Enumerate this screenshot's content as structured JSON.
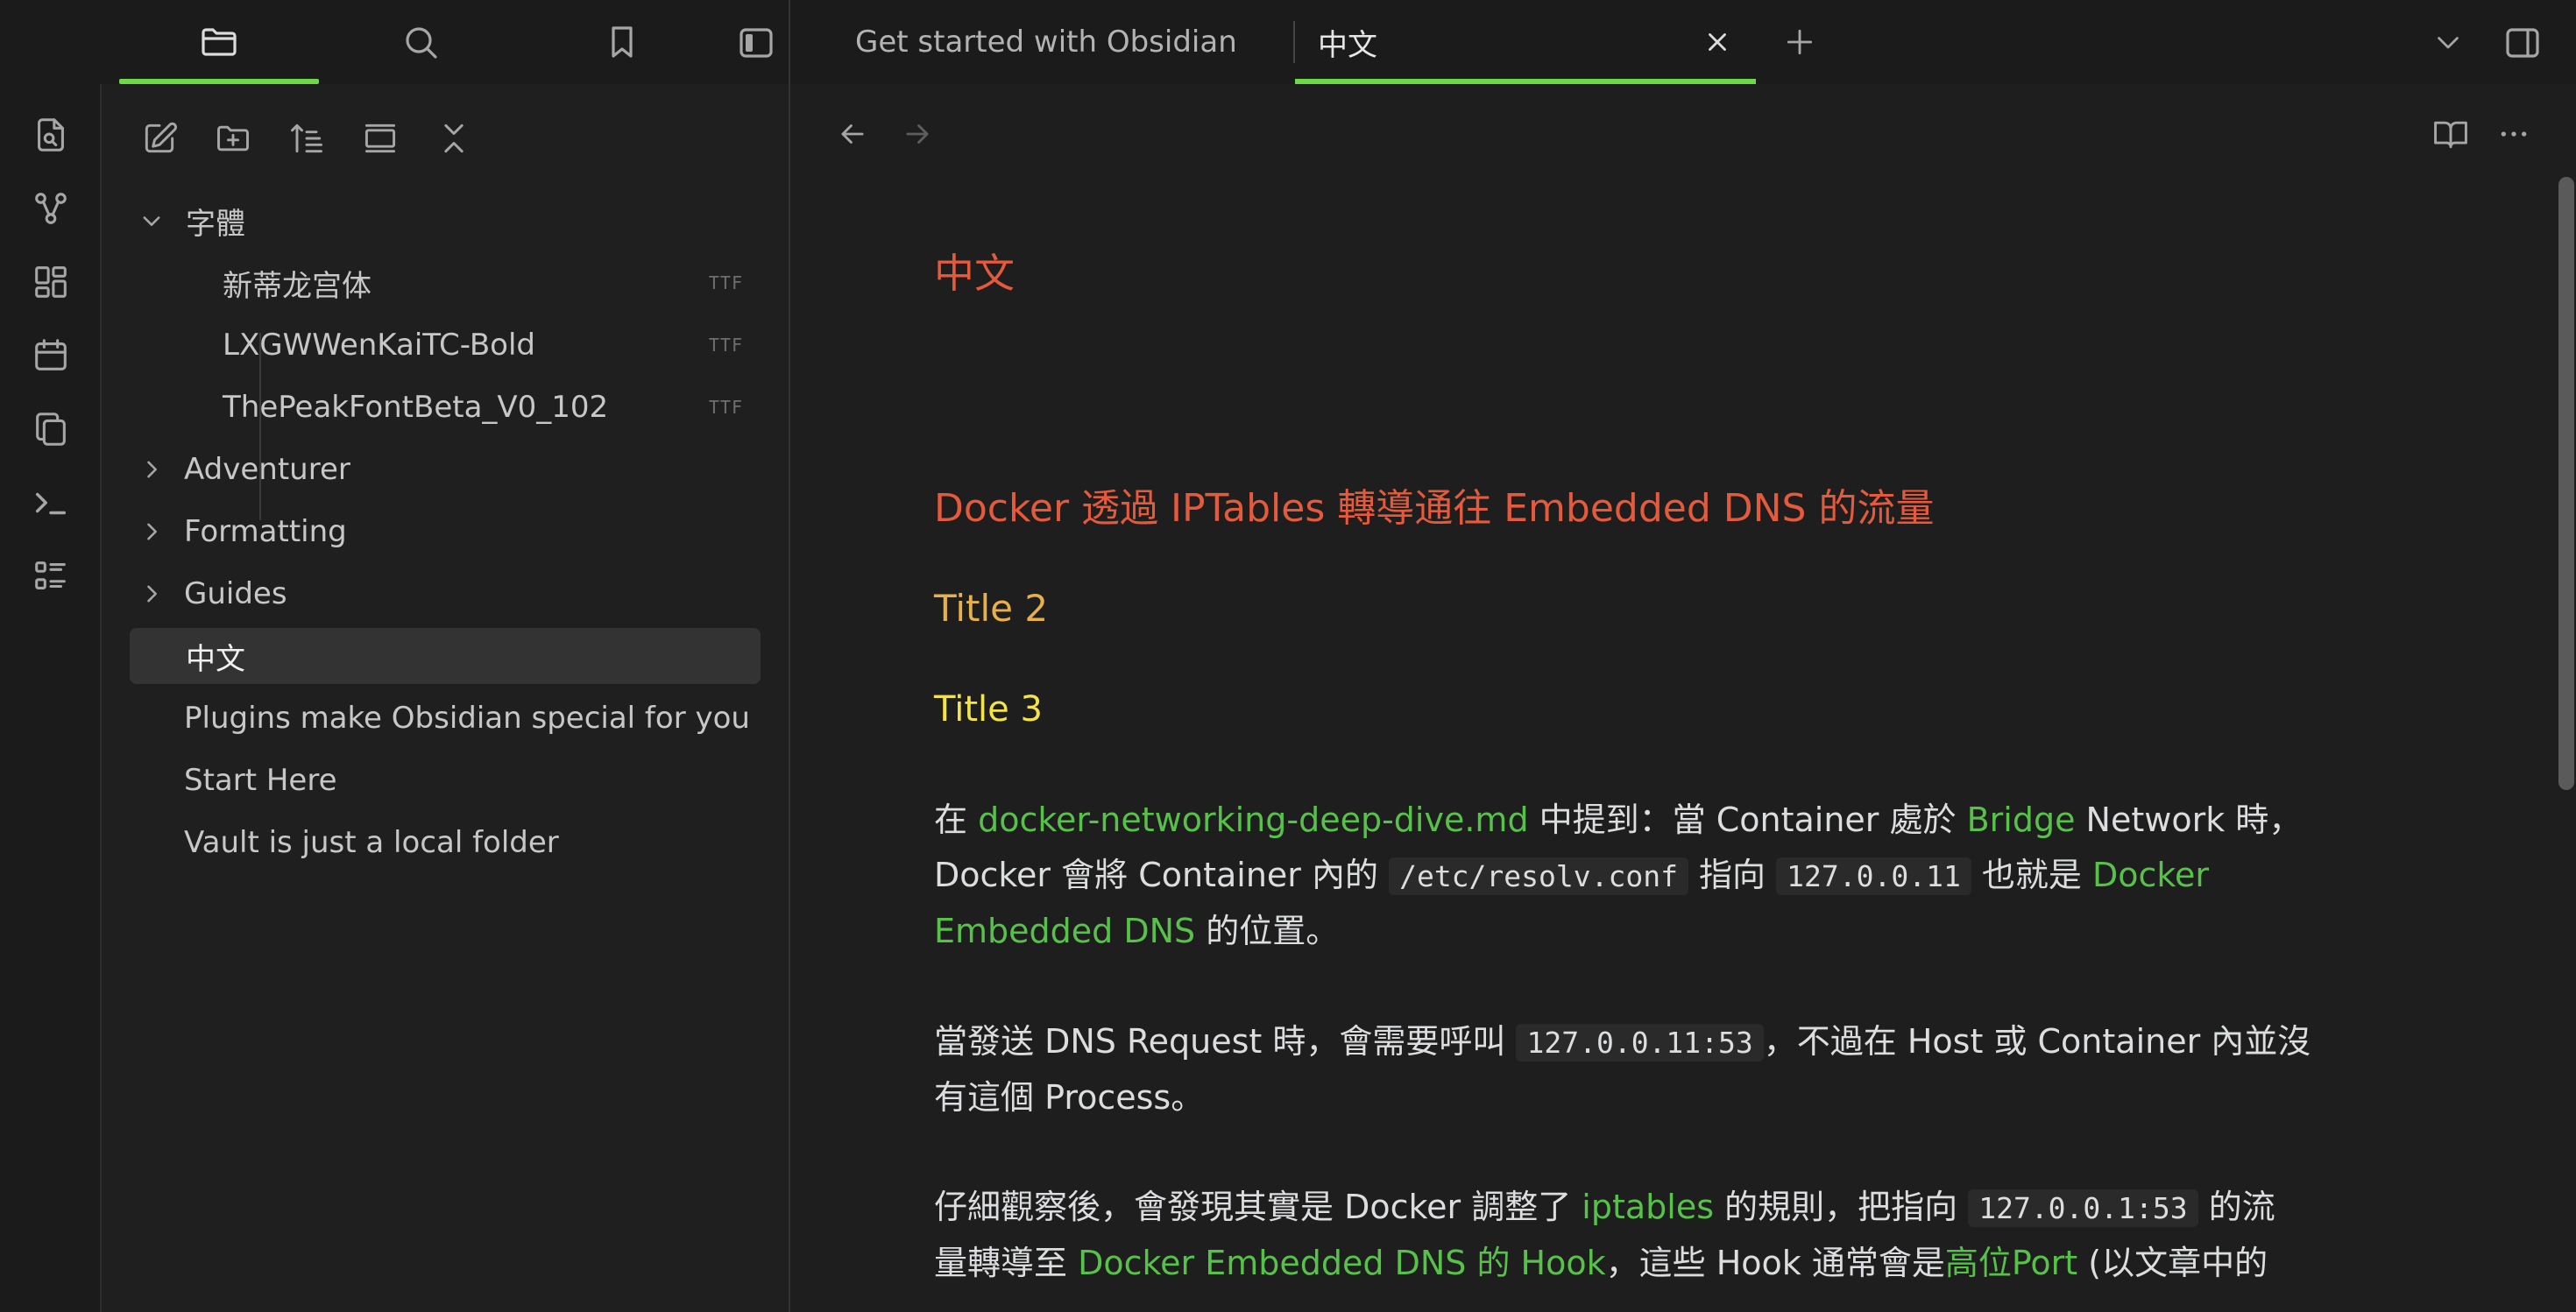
{
  "app": {
    "accent_color": "#6fd84a",
    "heading_colors": {
      "h1": "#e45a3c",
      "h2": "#e8b04a",
      "h3": "#f2e34a",
      "link": "#57c14a"
    }
  },
  "sidebar_tabs": [
    {
      "name": "files",
      "icon": "folder-icon",
      "active": true
    },
    {
      "name": "search",
      "icon": "search-icon",
      "active": false
    },
    {
      "name": "bookmarks",
      "icon": "bookmark-icon",
      "active": false
    }
  ],
  "tabs": [
    {
      "label": "Get started with Obsidian",
      "active": false
    },
    {
      "label": "中文",
      "active": true
    }
  ],
  "ribbon": [
    {
      "icon": "switcher-icon"
    },
    {
      "icon": "graph-icon"
    },
    {
      "icon": "canvas-icon"
    },
    {
      "icon": "calendar-icon"
    },
    {
      "icon": "copy-icon"
    },
    {
      "icon": "terminal-icon"
    },
    {
      "icon": "outline-icon"
    }
  ],
  "explorer": {
    "toolbar": [
      {
        "icon": "new-note-icon"
      },
      {
        "icon": "new-folder-icon"
      },
      {
        "icon": "sort-icon"
      },
      {
        "icon": "auto-reveal-icon"
      },
      {
        "icon": "collapse-all-icon"
      }
    ],
    "tree": [
      {
        "label": "字體",
        "type": "folder",
        "expanded": true
      },
      {
        "label": "新蒂龙宫体",
        "type": "file",
        "badge": "TTF",
        "indent": 1
      },
      {
        "label": "LXGWWenKaiTC-Bold",
        "type": "file",
        "badge": "TTF",
        "indent": 1
      },
      {
        "label": "ThePeakFontBeta_V0_102",
        "type": "file",
        "badge": "TTF",
        "indent": 1
      },
      {
        "label": "Adventurer",
        "type": "folder",
        "expanded": false
      },
      {
        "label": "Formatting",
        "type": "folder",
        "expanded": false
      },
      {
        "label": "Guides",
        "type": "folder",
        "expanded": false
      },
      {
        "label": "中文",
        "type": "file",
        "selected": true
      },
      {
        "label": "Plugins make Obsidian special for you",
        "type": "file"
      },
      {
        "label": "Start Here",
        "type": "file"
      },
      {
        "label": "Vault is just a local folder",
        "type": "file"
      }
    ]
  },
  "document": {
    "title": "中文",
    "heading_docker": "Docker 透過 IPTables 轉導通往 Embedded DNS 的流量",
    "title2": "Title 2",
    "title3": "Title 3",
    "p1": {
      "t1": "在 ",
      "link1": "docker-networking-deep-dive.md",
      "t2": " 中提到：當 Container 處於 ",
      "link2": "Bridge",
      "t3": " Network 時，",
      "t4": "Docker 會將 Container 內的 ",
      "code1": "/etc/resolv.conf",
      "t5": " 指向 ",
      "code2": "127.0.0.11",
      "t6": " 也就是 ",
      "link3a": "Docker",
      "link3b": "Embedded DNS",
      "t7": " 的位置。"
    },
    "p2": {
      "t1": "當發送 DNS Request 時，會需要呼叫 ",
      "code1": "127.0.0.11:53",
      "t2": "，不過在 Host 或 Container 內並沒",
      "t3": "有這個 Process。"
    },
    "p3": {
      "t1": "仔細觀察後，會發現其實是 Docker 調整了 ",
      "link1": "iptables",
      "t2": " 的規則，把指向 ",
      "code1": "127.0.0.1:53",
      "t3": " 的流",
      "t4": "量轉導至 ",
      "link2": "Docker Embedded DNS 的 Hook",
      "t5": "，這些 Hook 通常會是",
      "link3": "高位Port",
      "t6": " (以文章中的"
    }
  }
}
